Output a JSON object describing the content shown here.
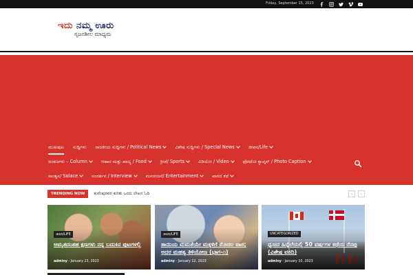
{
  "topbar": {
    "date": "Friday, September 15, 2023",
    "social_icons": [
      "facebook-icon",
      "instagram-icon",
      "twitter-icon",
      "vimeo-icon",
      "youtube-icon"
    ]
  },
  "logo": {
    "line1_part1": "ಇದು",
    "line1_part2": "ನಮ್ಮ ಊರು",
    "line2": "ಸೃಜನಶೀಲ ಮಾಧ್ಯಮ"
  },
  "nav": {
    "row1": [
      {
        "label": "ಮುಖಪುಟ",
        "dropdown": false,
        "active": true
      },
      {
        "label": "ಸುದ್ದಿಗಳು",
        "dropdown": false
      },
      {
        "label": "ರಾಜಕೀಯ ಸುದ್ದಿಗಳು / Political News",
        "dropdown": true
      },
      {
        "label": "ವಿಶೇಷ ಸುದ್ದಿಗಳು / Special News",
        "dropdown": true
      },
      {
        "label": "ಜೀವನ/Life",
        "dropdown": true
      }
    ],
    "row2": [
      {
        "label": "ಅಂಕಣಗಳು – Column",
        "dropdown": true
      },
      {
        "label": "ಆಹಾರ ಮತ್ತು ಖಾದ್ಯ / Food",
        "dropdown": true
      },
      {
        "label": "ಕ್ರೀಡೆ/ Sports",
        "dropdown": true
      },
      {
        "label": "ವಿಡಿಯೋ / Video",
        "dropdown": true
      },
      {
        "label": "ಫೋಟೋ ಕ್ಯಾಪ್ಶನ್ / Photo Caption",
        "dropdown": true
      }
    ],
    "row3": [
      {
        "label": "ಸಾಂತ್ವನ/ Solace",
        "dropdown": true
      },
      {
        "label": "ಸಂದರ್ಶನ / Interview",
        "dropdown": true
      },
      {
        "label": "ಮನರಂಜನೆ/ Entertainment",
        "dropdown": true
      },
      {
        "label": "ವಾರದ ಕಥೆ",
        "dropdown": true
      }
    ]
  },
  "trending": {
    "badge": "TRENDING NOW",
    "title": "ಕುವೆಂಪುರವರ ಕುರಿತು ಒಂದು ಲೇಖನ ಓದಿ",
    "prev": "‹",
    "next": "›"
  },
  "cards": [
    {
      "category": "ಜೀವನ/LIFE",
      "title": "ಅಮೃತದಂತಹ ಕ್ಷಣಗಳು ನನ್ನ ಬದುಕಿನ ಪುಟಗಳಲ್ಲಿ",
      "author": "adminy",
      "date": "January 23, 2023"
    },
    {
      "category": "ಜೀವನ/LIFE",
      "title": "ತಾಯಿಯ ಮಮತೆಯೇ ಮಕ್ಕಳಿಗೆ ಮೊದಲ ಪಾಠ; ಅದರ ಮಹತ್ವ ತಿಳಿಯೋಣ (ಭಾಗ-೧)",
      "author": "adminy",
      "date": "January 12, 2023"
    },
    {
      "category": "UNCATEGORIZED",
      "title": "ಧ್ವಜದ ಹಿನ್ನೆಲೆಯಲ್ಲಿ 50 ವರ್ಷಗಳ ಕಥೆಯ ನೆನಪು (ವಿಶೇಷ ವರದಿ)",
      "author": "adminy",
      "date": "January 10, 2023"
    }
  ],
  "colors": {
    "brand_red": "#d7322c",
    "topbar": "#111111"
  }
}
